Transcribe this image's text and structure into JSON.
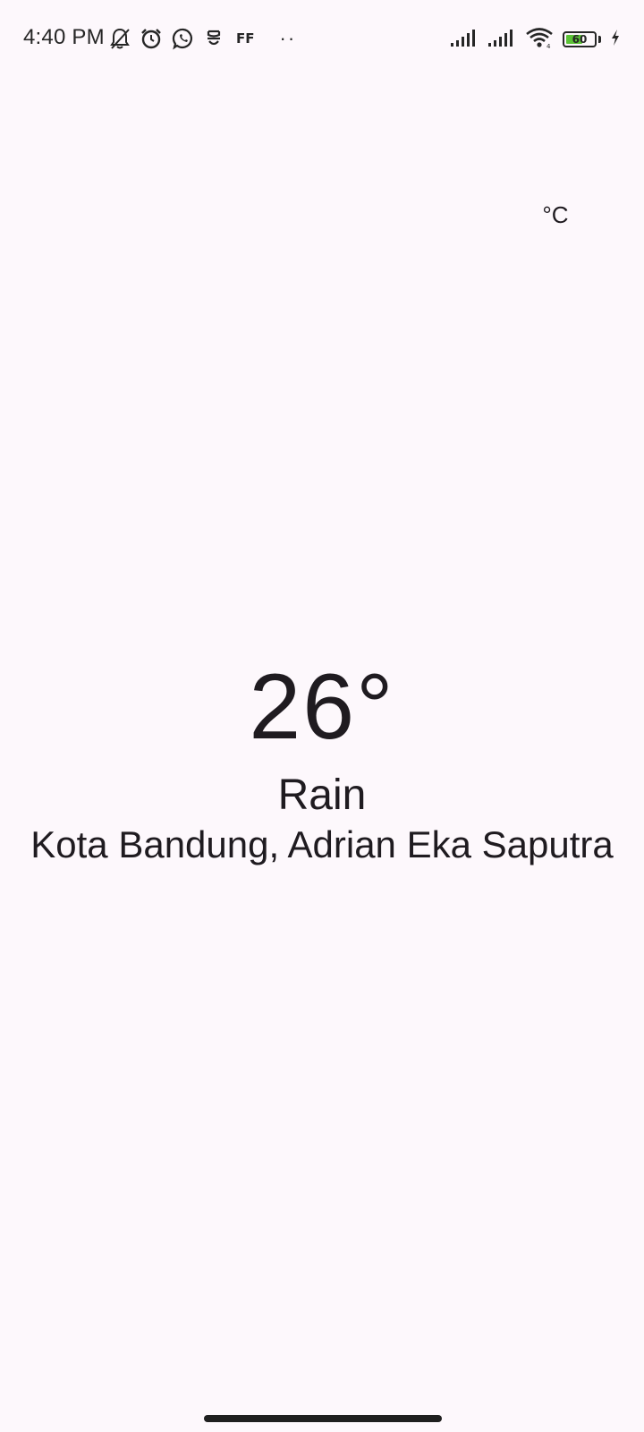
{
  "status_bar": {
    "time": "4:40 PM",
    "left_icons": [
      "bell-off-icon",
      "alarm-icon",
      "whatsapp-icon",
      "app-notification-icon",
      "ff-icon"
    ],
    "ff_label": "FF",
    "more_indicator": "··",
    "right_icons": [
      "signal-icon",
      "signal-icon",
      "wifi-icon",
      "battery-icon",
      "charging-icon"
    ],
    "battery_level": "60",
    "battery_fill_percent": 60,
    "battery_color": "#5BC236"
  },
  "unit_toggle": {
    "label": "°C"
  },
  "weather": {
    "temperature": "26°",
    "condition": "Rain",
    "location": "Kota Bandung, Adrian Eka Saputra"
  },
  "theme": {
    "background": "#FDF8FC",
    "text": "#1F1B20"
  }
}
